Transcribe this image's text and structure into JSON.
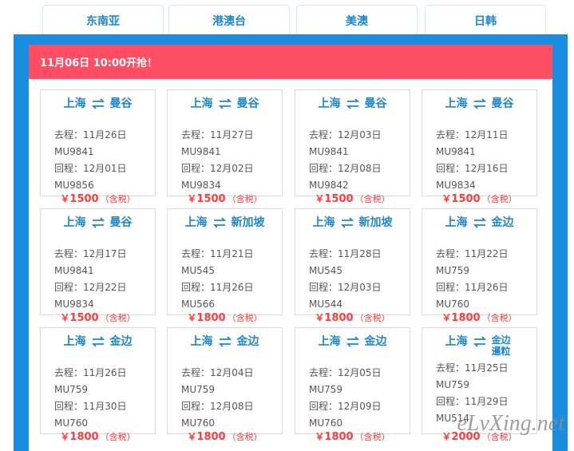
{
  "tabs": [
    {
      "label": "东南亚"
    },
    {
      "label": "港澳台"
    },
    {
      "label": "美澳"
    },
    {
      "label": "日韩"
    }
  ],
  "announcement": {
    "text": "11月06日 10:00开抢！"
  },
  "labels": {
    "depart": "去程：",
    "return": "回程：",
    "currency": "￥",
    "tax": "（含税）"
  },
  "cards": [
    {
      "from": "上海",
      "to": "曼谷",
      "depart_date": "11月26日",
      "depart_flight": "MU9841",
      "return_date": "12月01日",
      "return_flight": "MU9856",
      "price": "1500"
    },
    {
      "from": "上海",
      "to": "曼谷",
      "depart_date": "11月27日",
      "depart_flight": "MU9841",
      "return_date": "12月02日",
      "return_flight": "MU9834",
      "price": "1500"
    },
    {
      "from": "上海",
      "to": "曼谷",
      "depart_date": "12月03日",
      "depart_flight": "MU9841",
      "return_date": "12月08日",
      "return_flight": "MU9842",
      "price": "1500"
    },
    {
      "from": "上海",
      "to": "曼谷",
      "depart_date": "12月11日",
      "depart_flight": "MU9841",
      "return_date": "12月16日",
      "return_flight": "MU9834",
      "price": "1500"
    },
    {
      "from": "上海",
      "to": "曼谷",
      "depart_date": "12月17日",
      "depart_flight": "MU9841",
      "return_date": "12月22日",
      "return_flight": "MU9834",
      "price": "1500"
    },
    {
      "from": "上海",
      "to": "新加坡",
      "depart_date": "11月21日",
      "depart_flight": "MU545",
      "return_date": "11月26日",
      "return_flight": "MU566",
      "price": "1800"
    },
    {
      "from": "上海",
      "to": "新加坡",
      "depart_date": "11月28日",
      "depart_flight": "MU545",
      "return_date": "12月03日",
      "return_flight": "MU544",
      "price": "1800"
    },
    {
      "from": "上海",
      "to": "金边",
      "depart_date": "11月22日",
      "depart_flight": "MU759",
      "return_date": "11月26日",
      "return_flight": "MU760",
      "price": "1800"
    },
    {
      "from": "上海",
      "to": "金边",
      "depart_date": "11月26日",
      "depart_flight": "MU759",
      "return_date": "11月30日",
      "return_flight": "MU760",
      "price": "1800"
    },
    {
      "from": "上海",
      "to": "金边",
      "depart_date": "12月04日",
      "depart_flight": "MU759",
      "return_date": "12月08日",
      "return_flight": "MU760",
      "price": "1800"
    },
    {
      "from": "上海",
      "to": "金边",
      "depart_date": "12月05日",
      "depart_flight": "MU759",
      "return_date": "12月09日",
      "return_flight": "MU760",
      "price": "1800"
    },
    {
      "from": "上海",
      "to": "金边暹粒",
      "depart_date": "11月25日",
      "depart_flight": "MU759",
      "return_date": "11月29日",
      "return_flight": "MU514",
      "price": "2000"
    }
  ],
  "watermark": {
    "text": "eLvXing.net"
  },
  "colors": {
    "accent": "#1a8de0",
    "tab_text": "#1f86c9",
    "banner": "#ff4e63",
    "price": "#ff3b3b"
  },
  "icons": {
    "swap": "swap-icon"
  }
}
